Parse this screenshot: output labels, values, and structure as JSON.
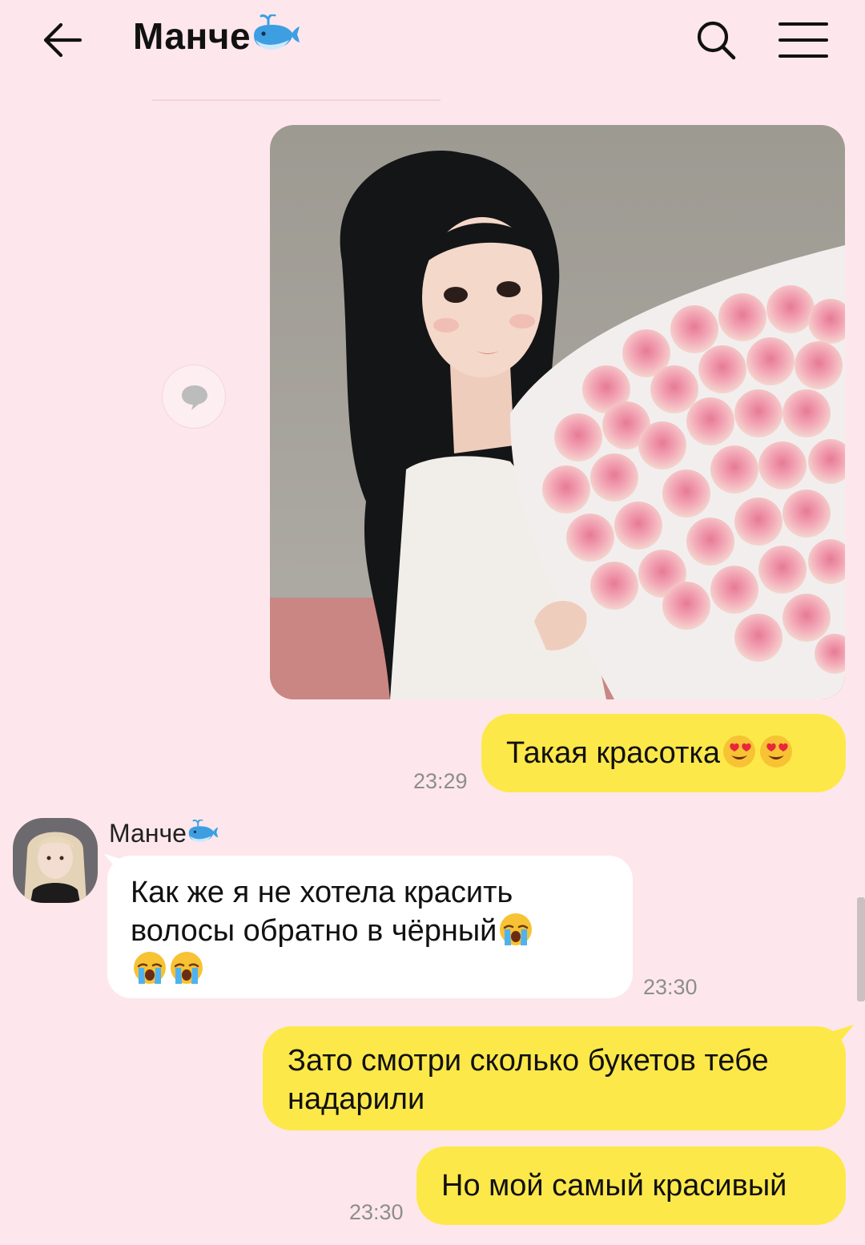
{
  "header": {
    "title": "Манче",
    "title_emoji": "spouting-whale"
  },
  "messages": [
    {
      "type": "image",
      "direction": "outgoing",
      "description_icon": "photo-girl-with-pink-roses"
    },
    {
      "type": "text",
      "direction": "outgoing",
      "text": "Такая красотка",
      "emoji": [
        "heart-eyes",
        "heart-eyes"
      ],
      "time": "23:29"
    },
    {
      "type": "text",
      "direction": "incoming",
      "sender": "Манче",
      "sender_emoji": "spouting-whale",
      "line1": "Как же я не хотела красить",
      "line2": "волосы обратно в чёрный",
      "emoji": [
        "loudly-crying",
        "loudly-crying",
        "loudly-crying"
      ],
      "time": "23:30"
    },
    {
      "type": "text",
      "direction": "outgoing",
      "line1": "Зато смотри сколько букетов тебе",
      "line2": "надарили"
    },
    {
      "type": "text",
      "direction": "outgoing",
      "text": "Но мой самый красивый",
      "time": "23:30"
    }
  ],
  "colors": {
    "background": "#fde7ec",
    "outgoing_bubble": "#fde84a",
    "incoming_bubble": "#ffffff",
    "time_text": "#8d8d8d"
  }
}
